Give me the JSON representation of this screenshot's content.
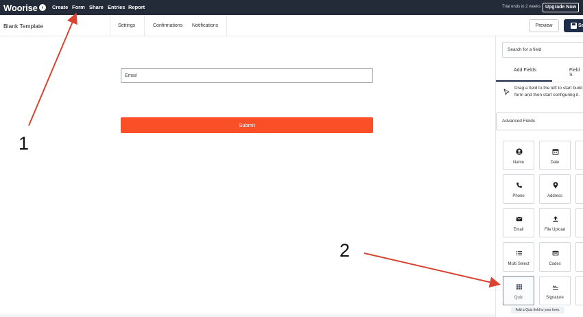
{
  "app": {
    "logo": "Woorise",
    "nav": [
      "Create",
      "Form",
      "Share",
      "Entries",
      "Report"
    ],
    "trial_text": "Trial ends in 2 weeks",
    "upgrade_label": "Upgrade Now"
  },
  "header": {
    "title": "Blank Template",
    "tabs": [
      "Settings",
      "Confirmations",
      "Notifications"
    ],
    "preview_label": "Preview",
    "save_label": "Sa"
  },
  "form": {
    "email_placeholder": "Email",
    "submit_label": "Submit"
  },
  "panel": {
    "search_placeholder": "Search for a field",
    "tabs": [
      "Add Fields",
      "Field S"
    ],
    "hint": "Drag a field to the left to start build form and then start configuring it.",
    "section": "Advanced Fields",
    "fields": [
      "Name",
      "Date",
      "Phone",
      "Address",
      "Email",
      "File Upload",
      "Multi Select",
      "Codes",
      "Quiz",
      "Signature"
    ],
    "tooltip": "Add a Quiz field to your form."
  },
  "annotations": [
    "1",
    "2"
  ],
  "colors": {
    "nav_bg": "#232b38",
    "submit": "#fb4f27",
    "arrow": "#d9432f",
    "save_bg": "#1d2d48"
  }
}
